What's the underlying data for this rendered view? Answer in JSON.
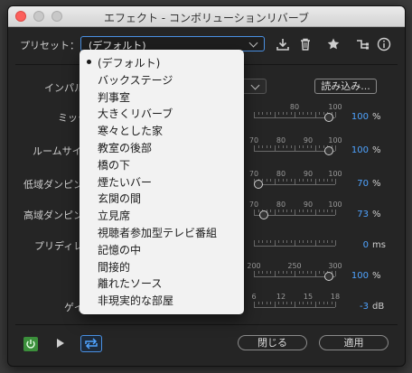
{
  "window": {
    "title": "エフェクト - コンボリューションリバーブ"
  },
  "toolbar": {
    "preset_label": "プリセット：",
    "preset_value": "(デフォルト)",
    "icons": [
      "download-icon",
      "trash-icon",
      "star-icon",
      "routing-icon",
      "info-icon"
    ]
  },
  "impulse": {
    "label": "インパル",
    "load_button": "読み込み..."
  },
  "params": [
    {
      "label": "ミック",
      "scale": [
        "80",
        "100"
      ],
      "value": "100",
      "unit": "%"
    },
    {
      "label": "ルームサイ",
      "scale": [
        "70",
        "80",
        "90",
        "100"
      ],
      "value": "100",
      "unit": "%"
    },
    {
      "label": "低域ダンピン",
      "scale": [
        "70",
        "80",
        "90",
        "100"
      ],
      "value": "70",
      "unit": "%"
    },
    {
      "label": "高域ダンピン",
      "scale": [
        "70",
        "80",
        "90",
        "100"
      ],
      "value": "73",
      "unit": "%"
    },
    {
      "label": "プリディレ",
      "scale": [],
      "value": "0",
      "unit": "ms"
    },
    {
      "label": "",
      "scale": [
        "200",
        "250",
        "300"
      ],
      "value": "100",
      "unit": "%"
    },
    {
      "label": "ゲイ",
      "scale": [
        "6",
        "12",
        "15",
        "18"
      ],
      "value": "-3",
      "unit": "dB"
    }
  ],
  "preset_menu": {
    "items": [
      "(デフォルト)",
      "バックステージ",
      "判事室",
      "大きくリバーブ",
      "寒々とした家",
      "教室の後部",
      "橋の下",
      "煙たいバー",
      "玄関の間",
      "立見席",
      "視聴者参加型テレビ番組",
      "記憶の中",
      "間接的",
      "離れたソース",
      "非現実的な部屋"
    ],
    "selected_index": 0
  },
  "footer": {
    "close_button": "閉じる",
    "apply_button": "適用"
  },
  "colors": {
    "accent": "#4a90e2",
    "value_blue": "#4fa3ff",
    "power_green": "#3b8f3b"
  }
}
